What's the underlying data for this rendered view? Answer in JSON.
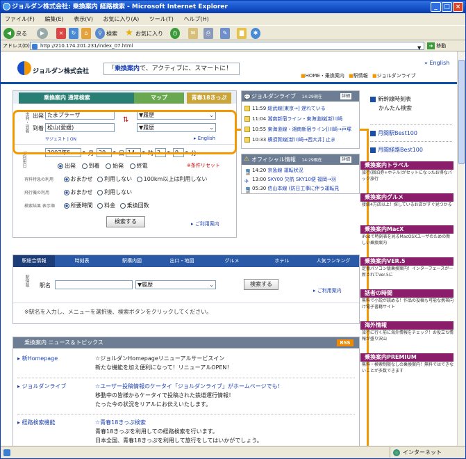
{
  "window": {
    "title": "ジョルダン株式会社: 乗換案内 経路検索 - Microsoft Internet Explorer",
    "minimize": "_",
    "maximize": "□",
    "close": "×"
  },
  "menubar": [
    "ファイル(F)",
    "編集(E)",
    "表示(V)",
    "お気に入り(A)",
    "ツール(T)",
    "ヘルプ(H)"
  ],
  "toolbar": {
    "back": "戻る",
    "search": "検索",
    "favorites": "お気に入り"
  },
  "addressbar": {
    "label": "アドレス(D)",
    "url": "http://210.174.201.231/index_07.html",
    "go": "移動"
  },
  "site": {
    "logo_text": "ジョルダン株式会社",
    "tagline_pre": "「",
    "tagline_em": "乗換案内",
    "tagline_post": "で、アクティブに、スマートに！",
    "english": "English",
    "nav": [
      "HOME・乗換案内",
      "駅情報",
      "ジョルダンライブ"
    ]
  },
  "search": {
    "tabs": [
      "乗換案内 通常検索",
      "マップ",
      "青春18きっぷ"
    ],
    "side_label": "出発・到着",
    "depart_label": "出発",
    "depart_value": "たまプラーザ",
    "arrive_label": "到着",
    "arrive_value": "松山(愛媛)",
    "history": "▼履歴",
    "suggest": "サジェスト | ON",
    "english": "English",
    "date_side": "ご利用日",
    "year": "2007年5",
    "month_unit": "月",
    "day": "29",
    "day_unit": "日",
    "hour": "14",
    "hour_unit": "時",
    "minute": "2",
    "minute2": "9",
    "minute_unit": "分",
    "time_options": [
      "出発",
      "到着",
      "始発",
      "終電"
    ],
    "reset": "条件リセット",
    "opt_rows": [
      {
        "label": "有料特急の利用",
        "opts": [
          "おまかせ",
          "利用しない",
          "100km以上は利用しない"
        ]
      },
      {
        "label": "飛行機の利用",
        "opts": [
          "おまかせ",
          "利用しない"
        ]
      },
      {
        "label": "検索結果 表示順",
        "opts": [
          "所要時間",
          "料金",
          "乗換回数"
        ]
      }
    ],
    "submit": "検索する",
    "help": "ご利用案内"
  },
  "live": {
    "title": "ジョルダンライブ",
    "time": "14:29現在",
    "detail": "詳細",
    "items": [
      {
        "time": "11:59",
        "text": "総武線[東京→]  遅れている"
      },
      {
        "time": "11:04",
        "text": "湘南新宿ライン・東海道線[新川崎"
      },
      {
        "time": "10:55",
        "text": "東海道線・湘南新宿ライン[川崎→戸塚"
      },
      {
        "time": "10:33",
        "text": "横須賀線[新川崎→西大井]  止ま"
      }
    ]
  },
  "official": {
    "title": "オフィシャル情報",
    "time": "14:29現在",
    "detail": "詳細",
    "items": [
      {
        "time": "14:20",
        "text": "京急線  運転状況"
      },
      {
        "time": "13:00",
        "text": "SKY00  欠航 SKY10便 福岡→羽"
      },
      {
        "time": "05:30",
        "text": "信山本線  (防日工事に伴う運転見"
      }
    ]
  },
  "right_links": [
    {
      "title": "新幹線時刻表",
      "sub": "かんたん検索"
    },
    {
      "title": "月間駅Best100",
      "sub": ""
    },
    {
      "title": "月間経路Best100",
      "sub": ""
    }
  ],
  "promos": [
    {
      "title": "乗換案内トラベル",
      "text": "旅行(宿泊券+ホテル)がセットになったお得なパック旅行"
    },
    {
      "title": "乗換案内グルメ",
      "text": "接続4万店以上！探しているお店がすぐ見つかる"
    },
    {
      "title": "乗換案内MacX",
      "text": "iPodで時刻表を見るMacOSXユーザのための新しい乗換案内"
    },
    {
      "title": "乗換案内VER.5",
      "text": "定番パソコン版乗換案内！インターフェースが一新されてVer.5に"
    },
    {
      "title": "話者の時間",
      "text": "無料で小説が読める！作品の投稿も可能な携帯向け電子書籍サイト"
    },
    {
      "title": "海外情報",
      "text": "旅行に行く前に海外情報をチェック！お役立ち情報が盛り沢山"
    },
    {
      "title": "乗換案内PREMIUM",
      "text": "無料・検索制限なしの乗換案内！無料ではできないことが多数できます"
    }
  ],
  "station": {
    "tabs": [
      "駅総合情報",
      "時刻表",
      "駅構内図",
      "出口・地図",
      "グルメ",
      "ホテル",
      "人気ランキング"
    ],
    "side_label": "駅情報",
    "name_label": "駅名",
    "history": "▼履歴",
    "submit": "検索する",
    "help": "ご利用案内",
    "hint": "※駅名を入力し、メニューを選択後、検索ボタンをクリックしてください。"
  },
  "news": {
    "title": "乗換案内 ニュース＆トピックス",
    "rss": "RSS",
    "items": [
      {
        "cat": "新Homepage",
        "lines": [
          "☆ジョルダンHomepageリニューアルサービスイン",
          "新たな機能を加え便利になって！リニューアルOPEN！"
        ]
      },
      {
        "cat": "ジョルダンライブ",
        "lines": [
          "☆ユーザー投稿情報のケータイ「ジョルダンライブ」がホームページでも！",
          "移動中の皆様からケータイで投稿された鉄道運行情報！",
          "たった今の状況をリアルにお伝えいたします。"
        ]
      },
      {
        "cat": "経路検索機能",
        "lines": [
          "☆青春18きっぷ検索",
          "青春18きっぷを利用しての経路検索を行います。",
          "日本全国、青春18きっぷを利用して旅行をしてはいかがでしょう。"
        ]
      }
    ]
  },
  "status": {
    "zone": "インターネット"
  },
  "colors": {
    "highlight": "#f39800",
    "title_blue": "#1450c8",
    "promo": "#8b1e6b",
    "tab_blue": "#2a5aa7"
  }
}
